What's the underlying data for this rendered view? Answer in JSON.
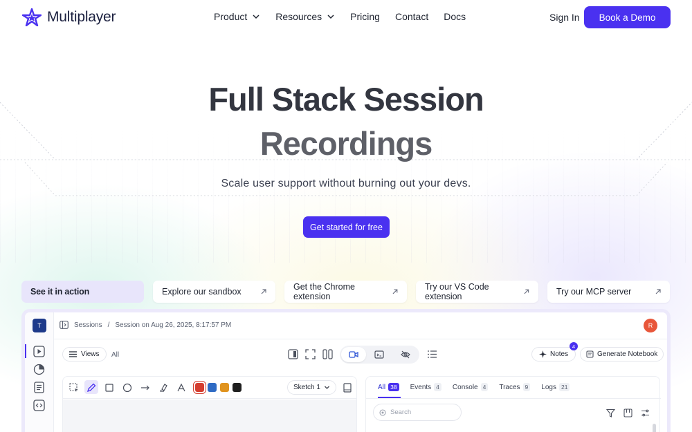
{
  "brand": {
    "name": "Multiplayer"
  },
  "nav": {
    "items": [
      {
        "label": "Product",
        "has_dropdown": true
      },
      {
        "label": "Resources",
        "has_dropdown": true
      },
      {
        "label": "Pricing",
        "has_dropdown": false
      },
      {
        "label": "Contact",
        "has_dropdown": false
      },
      {
        "label": "Docs",
        "has_dropdown": false
      }
    ],
    "sign_in": "Sign In",
    "demo": "Book a Demo"
  },
  "hero": {
    "title_line1": "Full Stack Session",
    "title_line2": "Recordings",
    "subtitle": "Scale user support without burning out your devs.",
    "cta": "Get started for free"
  },
  "tabs": [
    {
      "label": "See it in action",
      "active": true
    },
    {
      "label": "Explore our sandbox",
      "active": false
    },
    {
      "label": "Get the Chrome extension",
      "active": false
    },
    {
      "label": "Try our VS Code extension",
      "active": false
    },
    {
      "label": "Try our MCP server",
      "active": false
    }
  ],
  "app": {
    "user_initial": "T",
    "profile_initial": "R",
    "breadcrumb": {
      "root": "Sessions",
      "separator": "/",
      "current": "Session on Aug 26, 2025, 8:17:57 PM"
    },
    "toolbar": {
      "views": "Views",
      "all": "All",
      "notes": "Notes",
      "notes_count": "4",
      "generate": "Generate Notebook"
    },
    "sketch": {
      "select": "Sketch 1",
      "colors": [
        "#d43d2f",
        "#2f6bc4",
        "#e0931e",
        "#1f1f1f"
      ]
    },
    "panel": {
      "tabs": [
        {
          "label": "All",
          "count": "38"
        },
        {
          "label": "Events",
          "count": "4"
        },
        {
          "label": "Console",
          "count": "4"
        },
        {
          "label": "Traces",
          "count": "9"
        },
        {
          "label": "Logs",
          "count": "21"
        }
      ],
      "search_placeholder": "Search"
    }
  },
  "colors": {
    "accent": "#4a31f0",
    "accent_soft": "#e8e5fb",
    "text": "#1f2430"
  }
}
